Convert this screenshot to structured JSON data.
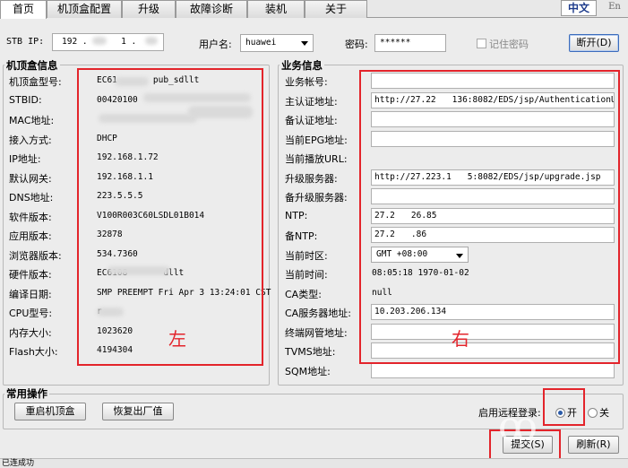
{
  "tabs": [
    {
      "label": "首页",
      "active": true
    },
    {
      "label": "机顶盒配置",
      "active": false
    },
    {
      "label": "升级",
      "active": false
    },
    {
      "label": "故障诊断",
      "active": false
    },
    {
      "label": "装机",
      "active": false
    },
    {
      "label": "关于",
      "active": false
    }
  ],
  "language": {
    "zh": "中文",
    "en": "En"
  },
  "login": {
    "stb_ip_label": "STB IP:",
    "stb_ip_value": "192 . ",
    "stb_ip_value2": "1 .",
    "username_label": "用户名:",
    "username_value": "huawei",
    "password_label": "密码:",
    "password_value": "******",
    "remember_label": "记住密码",
    "disconnect_button": "断开(D)"
  },
  "stb_info": {
    "title": "机顶盒信息",
    "rows": [
      {
        "label": "机顶盒型号:",
        "value": "EC61",
        "value_tail": "pub_sdllt"
      },
      {
        "label": "STBID:",
        "value": "00420100",
        "value_tail": ""
      },
      {
        "label": "MAC地址:",
        "value": "",
        "value_tail": ""
      },
      {
        "label": "接入方式:",
        "value": "DHCP",
        "value_tail": ""
      },
      {
        "label": "IP地址:",
        "value": "192.168.1.72",
        "value_tail": ""
      },
      {
        "label": "默认网关:",
        "value": "192.168.1.1",
        "value_tail": ""
      },
      {
        "label": "DNS地址:",
        "value": "223.5.5.5",
        "value_tail": ""
      },
      {
        "label": "软件版本:",
        "value": "V100R003C60LSDL01B014",
        "value_tail": ""
      },
      {
        "label": "应用版本:",
        "value": "32878",
        "value_tail": ""
      },
      {
        "label": "浏览器版本:",
        "value": "534.7360",
        "value_tail": ""
      },
      {
        "label": "硬件版本:",
        "value": "EC6108",
        "value_tail": "dllt"
      },
      {
        "label": "编译日期:",
        "value": "SMP PREEMPT Fri Apr 3 13:24:01 CST",
        "value_tail": ""
      },
      {
        "label": "CPU型号:",
        "value": "r",
        "value_tail": ""
      },
      {
        "label": "内存大小:",
        "value": "1023620",
        "value_tail": ""
      },
      {
        "label": "Flash大小:",
        "value": "4194304",
        "value_tail": ""
      }
    ],
    "annotation": "左"
  },
  "service_info": {
    "title": "业务信息",
    "rows": [
      {
        "label": "业务帐号:",
        "value": "",
        "kind": "box"
      },
      {
        "label": "主认证地址:",
        "value": "http://27.22",
        "value_tail": "136:8082/EDS/jsp/AuthenticationUR",
        "kind": "box"
      },
      {
        "label": "备认证地址:",
        "value": "",
        "kind": "box"
      },
      {
        "label": "当前EPG地址:",
        "value": "",
        "kind": "box"
      },
      {
        "label": "当前播放URL:",
        "value": "",
        "kind": "text"
      },
      {
        "label": "升级服务器:",
        "value": "http://27.223.1",
        "value_tail": "5:8082/EDS/jsp/upgrade.jsp",
        "kind": "box"
      },
      {
        "label": "备升级服务器:",
        "value": "",
        "kind": "box"
      },
      {
        "label": "NTP:",
        "value": "27.2",
        "value_tail": "26.85",
        "kind": "box"
      },
      {
        "label": "备NTP:",
        "value": "27.2",
        "value_tail": ".86",
        "kind": "box"
      },
      {
        "label": "当前时区:",
        "value": "GMT +08:00",
        "kind": "select"
      },
      {
        "label": "当前时间:",
        "value": "08:05:18 1970-01-02",
        "kind": "text"
      },
      {
        "label": "CA类型:",
        "value": "null",
        "kind": "text"
      },
      {
        "label": "CA服务器地址:",
        "value": "10.203.206.134",
        "kind": "box"
      },
      {
        "label": "终端网管地址:",
        "value": "",
        "kind": "box"
      },
      {
        "label": "TVMS地址:",
        "value": "",
        "kind": "box"
      },
      {
        "label": "SQM地址:",
        "value": "",
        "kind": "box"
      }
    ],
    "annotation": "右"
  },
  "common_ops": {
    "title": "常用操作",
    "reboot_button": "重启机顶盒",
    "factory_reset_button": "恢复出厂值"
  },
  "remote_login": {
    "label": "启用远程登录:",
    "on_label": "开",
    "off_label": "关",
    "selected": "on"
  },
  "footer": {
    "submit_button": "提交(S)",
    "refresh_button": "刷新(R)",
    "status_text": "已连成功"
  },
  "colors": {
    "annotation": "#e3242b",
    "accent": "#1e3c8c"
  }
}
